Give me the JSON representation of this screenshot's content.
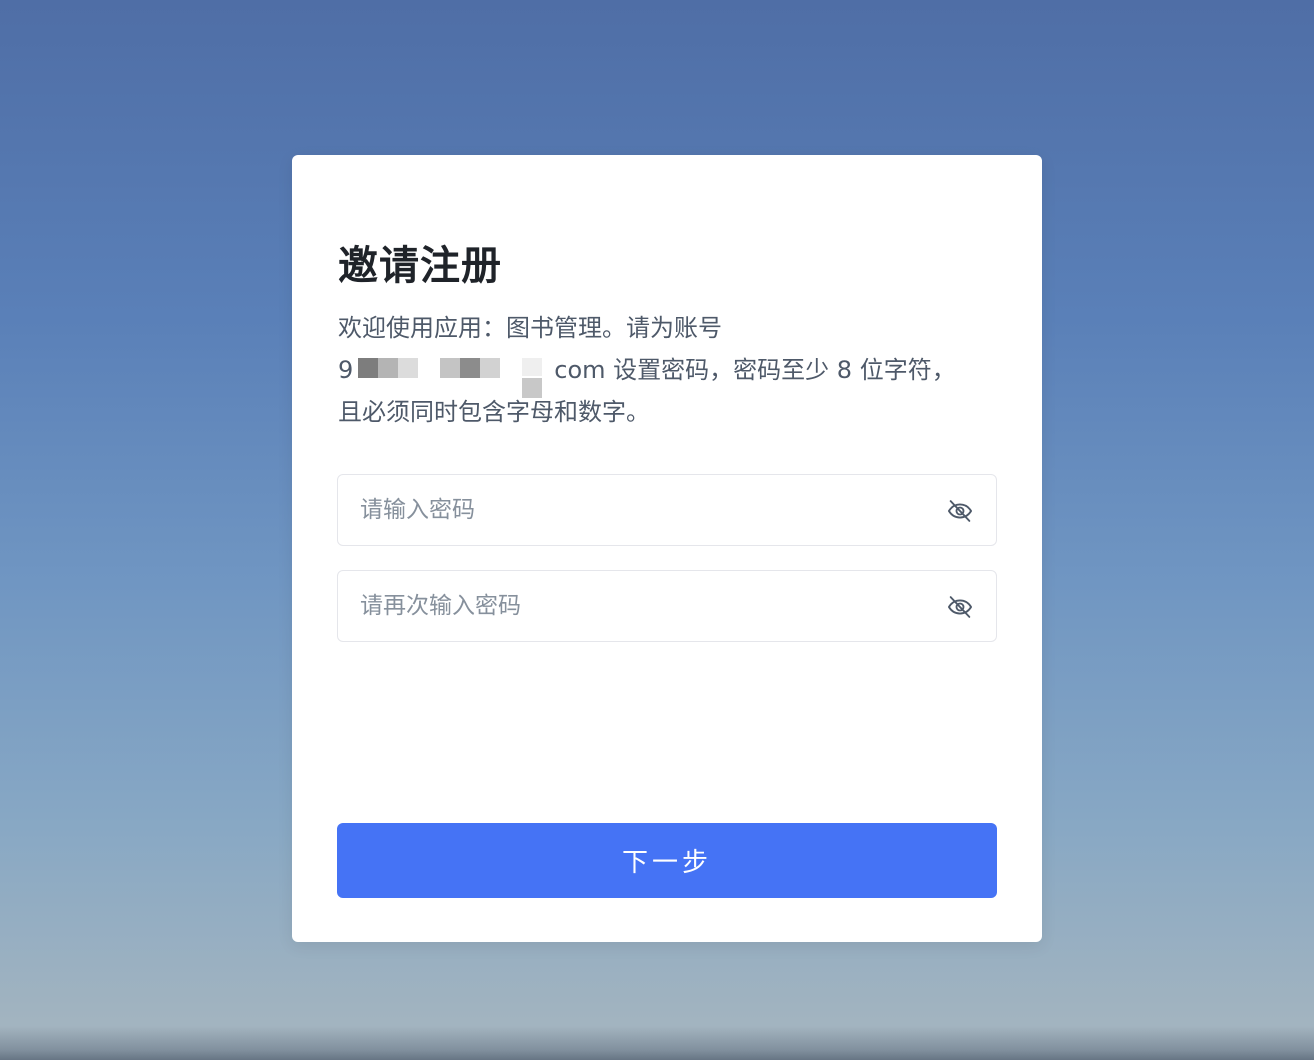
{
  "card": {
    "title": "邀请注册",
    "desc_line1": "欢迎使用应用：图书管理。请为账号",
    "account_prefix": "9",
    "desc_after_account": "com 设置密码，密码至少 8 位字符，",
    "desc_line3": "且必须同时包含字母和数字。"
  },
  "form": {
    "password_placeholder": "请输入密码",
    "confirm_placeholder": "请再次输入密码",
    "next_button_label": "下一步"
  },
  "icons": {
    "toggle_visibility": "eye-off-icon"
  },
  "colors": {
    "primary": "#4573f5",
    "title_text": "#1f2329",
    "body_text": "#4e5969",
    "placeholder": "#86909c",
    "border": "#e5e6eb"
  }
}
